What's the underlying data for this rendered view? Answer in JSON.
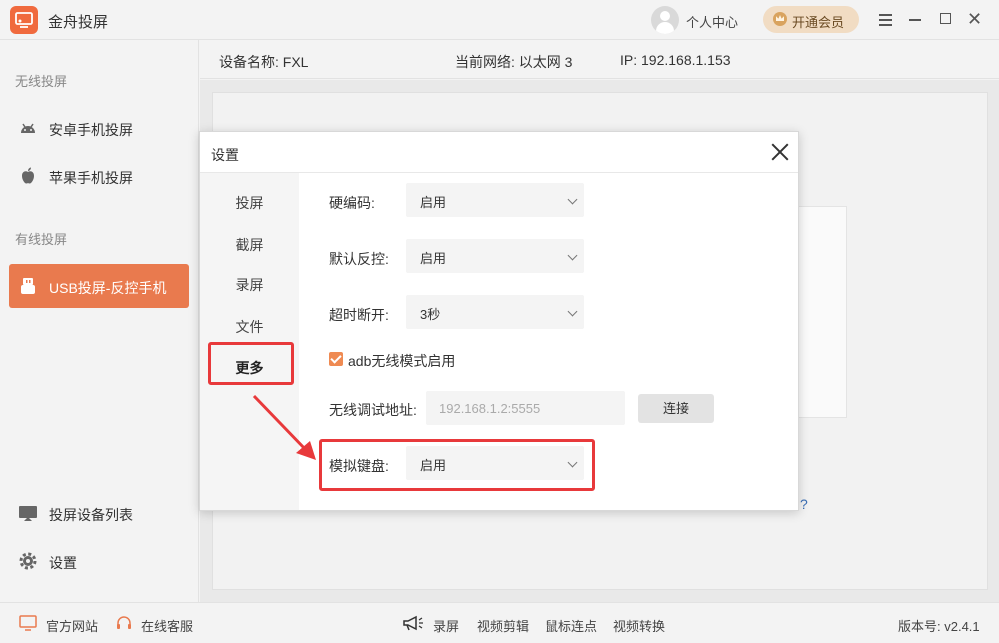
{
  "app": {
    "title": "金舟投屏"
  },
  "header": {
    "user_label": "个人中心",
    "vip_label": "开通会员"
  },
  "info": {
    "device_name": "设备名称: FXL",
    "network": "当前网络:  以太网 3",
    "ip": "IP: 192.168.1.153"
  },
  "sidebar": {
    "section_wireless": "无线投屏",
    "android": "安卓手机投屏",
    "apple": "苹果手机投屏",
    "section_wired": "有线投屏",
    "usb": "USB投屏-反控手机",
    "device_list": "投屏设备列表",
    "settings": "设置"
  },
  "footer": {
    "website": "官方网站",
    "support": "在线客服",
    "record": "录屏",
    "video_edit": "视频剪辑",
    "mouse_clicker": "鼠标连点",
    "video_convert": "视频转换",
    "version": "版本号: v2.4.1"
  },
  "dialog": {
    "title": "设置",
    "nav": [
      "投屏",
      "截屏",
      "录屏",
      "文件",
      "更多"
    ],
    "hw_encoding_label": "硬编码:",
    "hw_encoding_value": "启用",
    "default_control_label": "默认反控:",
    "default_control_value": "启用",
    "timeout_label": "超时断开:",
    "timeout_value": "3秒",
    "adb_label": "adb无线模式启用",
    "adb_checked": true,
    "addr_label": "无线调试地址:",
    "addr_placeholder": "192.168.1.2:5555",
    "connect_label": "连接",
    "keyboard_label": "模拟键盘:",
    "keyboard_value": "启用"
  },
  "help_mark": "?",
  "colors": {
    "accent": "#e97a4e",
    "highlight": "#e8393b",
    "checkbox": "#ef8a52"
  }
}
